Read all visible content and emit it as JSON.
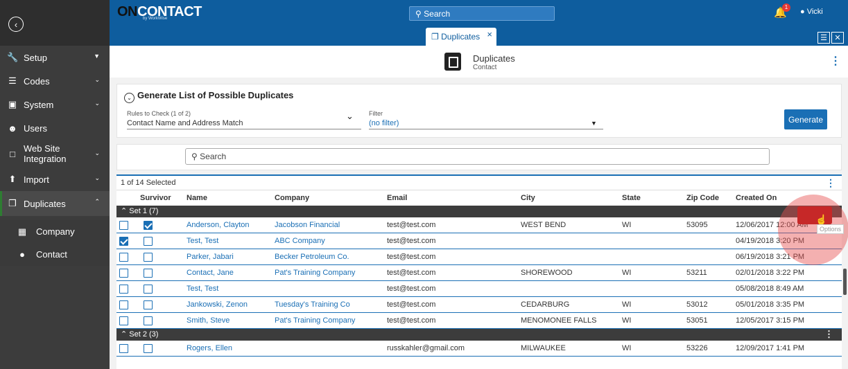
{
  "app": {
    "logo_on": "ON",
    "logo_contact": "CONTACT",
    "logo_sub": "by WorkWise",
    "search_placeholder": "Search",
    "notification_count": "1",
    "user_name": "Vicki",
    "active_tab": "Duplicates",
    "tab_close": "×"
  },
  "sidebar": {
    "items": [
      {
        "label": "Setup",
        "icon": "wrench-icon"
      },
      {
        "label": "Codes",
        "icon": "list-icon"
      },
      {
        "label": "System",
        "icon": "computer-icon"
      },
      {
        "label": "Users",
        "icon": "user-icon"
      },
      {
        "label": "Web Site Integration",
        "icon": "window-icon"
      },
      {
        "label": "Import",
        "icon": "upload-icon"
      },
      {
        "label": "Duplicates",
        "icon": "copy-icon"
      }
    ],
    "sub_items": [
      {
        "label": "Company",
        "icon": "building-icon"
      },
      {
        "label": "Contact",
        "icon": "person-icon"
      }
    ]
  },
  "page": {
    "title": "Duplicates",
    "subtitle": "Contact"
  },
  "generate": {
    "title": "Generate List of Possible Duplicates",
    "rules_label": "Rules to Check (1 of 2)",
    "rules_value": "Contact Name and Address Match",
    "filter_label": "Filter",
    "filter_value": "(no filter)",
    "button": "Generate"
  },
  "grid": {
    "search_placeholder": "Search",
    "selected_text": "1 of 14 Selected",
    "columns": {
      "survivor": "Survivor",
      "name": "Name",
      "company": "Company",
      "email": "Email",
      "city": "City",
      "state": "State",
      "zip": "Zip Code",
      "created": "Created On"
    },
    "set1_label": "Set 1 (7)",
    "set2_label": "Set 2 (3)",
    "options_tooltip": "Options",
    "rows": [
      {
        "name": "Anderson, Clayton",
        "company": "Jacobson Financial",
        "email": "test@test.com",
        "city": "WEST BEND",
        "state": "WI",
        "zip": "53095",
        "created": "12/06/2017 12:00 AM"
      },
      {
        "name": "Test, Test",
        "company": "ABC Company",
        "email": "test@test.com",
        "city": "",
        "state": "",
        "zip": "",
        "created": "04/19/2018 3:20 PM"
      },
      {
        "name": "Parker, Jabari",
        "company": "Becker Petroleum Co.",
        "email": "test@test.com",
        "city": "",
        "state": "",
        "zip": "",
        "created": "06/19/2018 3:21 PM"
      },
      {
        "name": "Contact, Jane",
        "company": "Pat's Training Company",
        "email": "test@test.com",
        "city": "SHOREWOOD",
        "state": "WI",
        "zip": "53211",
        "created": "02/01/2018 3:22 PM"
      },
      {
        "name": "Test, Test",
        "company": "",
        "email": "test@test.com",
        "city": "",
        "state": "",
        "zip": "",
        "created": "05/08/2018 8:49 AM"
      },
      {
        "name": "Jankowski, Zenon",
        "company": "Tuesday's Training Co",
        "email": "test@test.com",
        "city": "CEDARBURG",
        "state": "WI",
        "zip": "53012",
        "created": "05/01/2018 3:35 PM"
      },
      {
        "name": "Smith, Steve",
        "company": "Pat's Training Company",
        "email": "test@test.com",
        "city": "MENOMONEE FALLS",
        "state": "WI",
        "zip": "53051",
        "created": "12/05/2017 3:15 PM"
      },
      {
        "name": "Rogers, Ellen",
        "company": "",
        "email": "russkahler@gmail.com",
        "city": "MILWAUKEE",
        "state": "WI",
        "zip": "53226",
        "created": "12/09/2017 1:41 PM"
      }
    ]
  }
}
